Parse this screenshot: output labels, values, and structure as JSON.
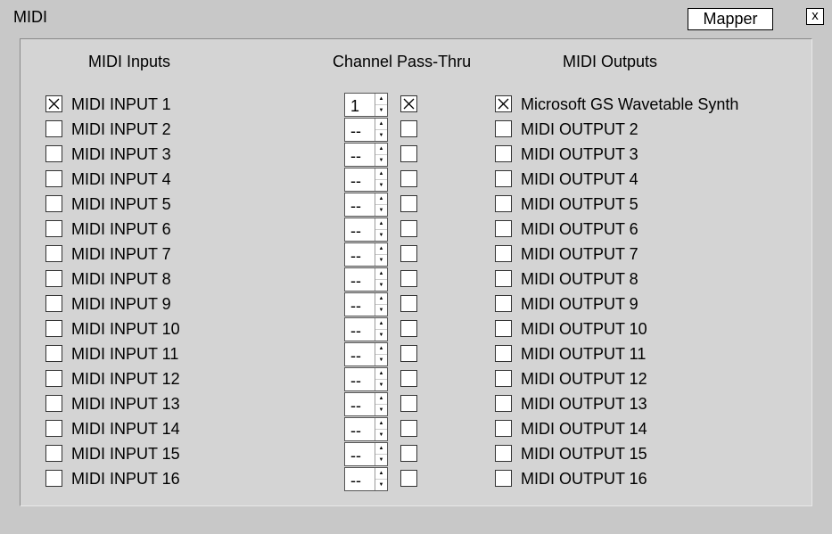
{
  "window": {
    "title": "MIDI",
    "mapper_label": "Mapper",
    "close_label": "x"
  },
  "headers": {
    "inputs": "MIDI Inputs",
    "pass_thru": "Channel Pass-Thru",
    "outputs": "MIDI Outputs"
  },
  "icons": {
    "check": "x-check-icon",
    "spin_up": "triangle-up-icon",
    "spin_down": "triangle-down-icon"
  },
  "rows": [
    {
      "input": "MIDI INPUT 1",
      "input_checked": true,
      "channel": "1",
      "pass_checked": true,
      "output": "Microsoft GS Wavetable Synth",
      "output_checked": true
    },
    {
      "input": "MIDI INPUT 2",
      "input_checked": false,
      "channel": "--",
      "pass_checked": false,
      "output": "MIDI OUTPUT 2",
      "output_checked": false
    },
    {
      "input": "MIDI INPUT 3",
      "input_checked": false,
      "channel": "--",
      "pass_checked": false,
      "output": "MIDI OUTPUT 3",
      "output_checked": false
    },
    {
      "input": "MIDI INPUT 4",
      "input_checked": false,
      "channel": "--",
      "pass_checked": false,
      "output": "MIDI OUTPUT 4",
      "output_checked": false
    },
    {
      "input": "MIDI INPUT 5",
      "input_checked": false,
      "channel": "--",
      "pass_checked": false,
      "output": "MIDI OUTPUT 5",
      "output_checked": false
    },
    {
      "input": "MIDI INPUT 6",
      "input_checked": false,
      "channel": "--",
      "pass_checked": false,
      "output": "MIDI OUTPUT 6",
      "output_checked": false
    },
    {
      "input": "MIDI INPUT 7",
      "input_checked": false,
      "channel": "--",
      "pass_checked": false,
      "output": "MIDI OUTPUT 7",
      "output_checked": false
    },
    {
      "input": "MIDI INPUT 8",
      "input_checked": false,
      "channel": "--",
      "pass_checked": false,
      "output": "MIDI OUTPUT 8",
      "output_checked": false
    },
    {
      "input": "MIDI INPUT 9",
      "input_checked": false,
      "channel": "--",
      "pass_checked": false,
      "output": "MIDI OUTPUT 9",
      "output_checked": false
    },
    {
      "input": "MIDI INPUT 10",
      "input_checked": false,
      "channel": "--",
      "pass_checked": false,
      "output": "MIDI OUTPUT 10",
      "output_checked": false
    },
    {
      "input": "MIDI INPUT 11",
      "input_checked": false,
      "channel": "--",
      "pass_checked": false,
      "output": "MIDI OUTPUT 11",
      "output_checked": false
    },
    {
      "input": "MIDI INPUT 12",
      "input_checked": false,
      "channel": "--",
      "pass_checked": false,
      "output": "MIDI OUTPUT 12",
      "output_checked": false
    },
    {
      "input": "MIDI INPUT 13",
      "input_checked": false,
      "channel": "--",
      "pass_checked": false,
      "output": "MIDI OUTPUT 13",
      "output_checked": false
    },
    {
      "input": "MIDI INPUT 14",
      "input_checked": false,
      "channel": "--",
      "pass_checked": false,
      "output": "MIDI OUTPUT 14",
      "output_checked": false
    },
    {
      "input": "MIDI INPUT 15",
      "input_checked": false,
      "channel": "--",
      "pass_checked": false,
      "output": "MIDI OUTPUT 15",
      "output_checked": false
    },
    {
      "input": "MIDI INPUT 16",
      "input_checked": false,
      "channel": "--",
      "pass_checked": false,
      "output": "MIDI OUTPUT 16",
      "output_checked": false
    }
  ]
}
